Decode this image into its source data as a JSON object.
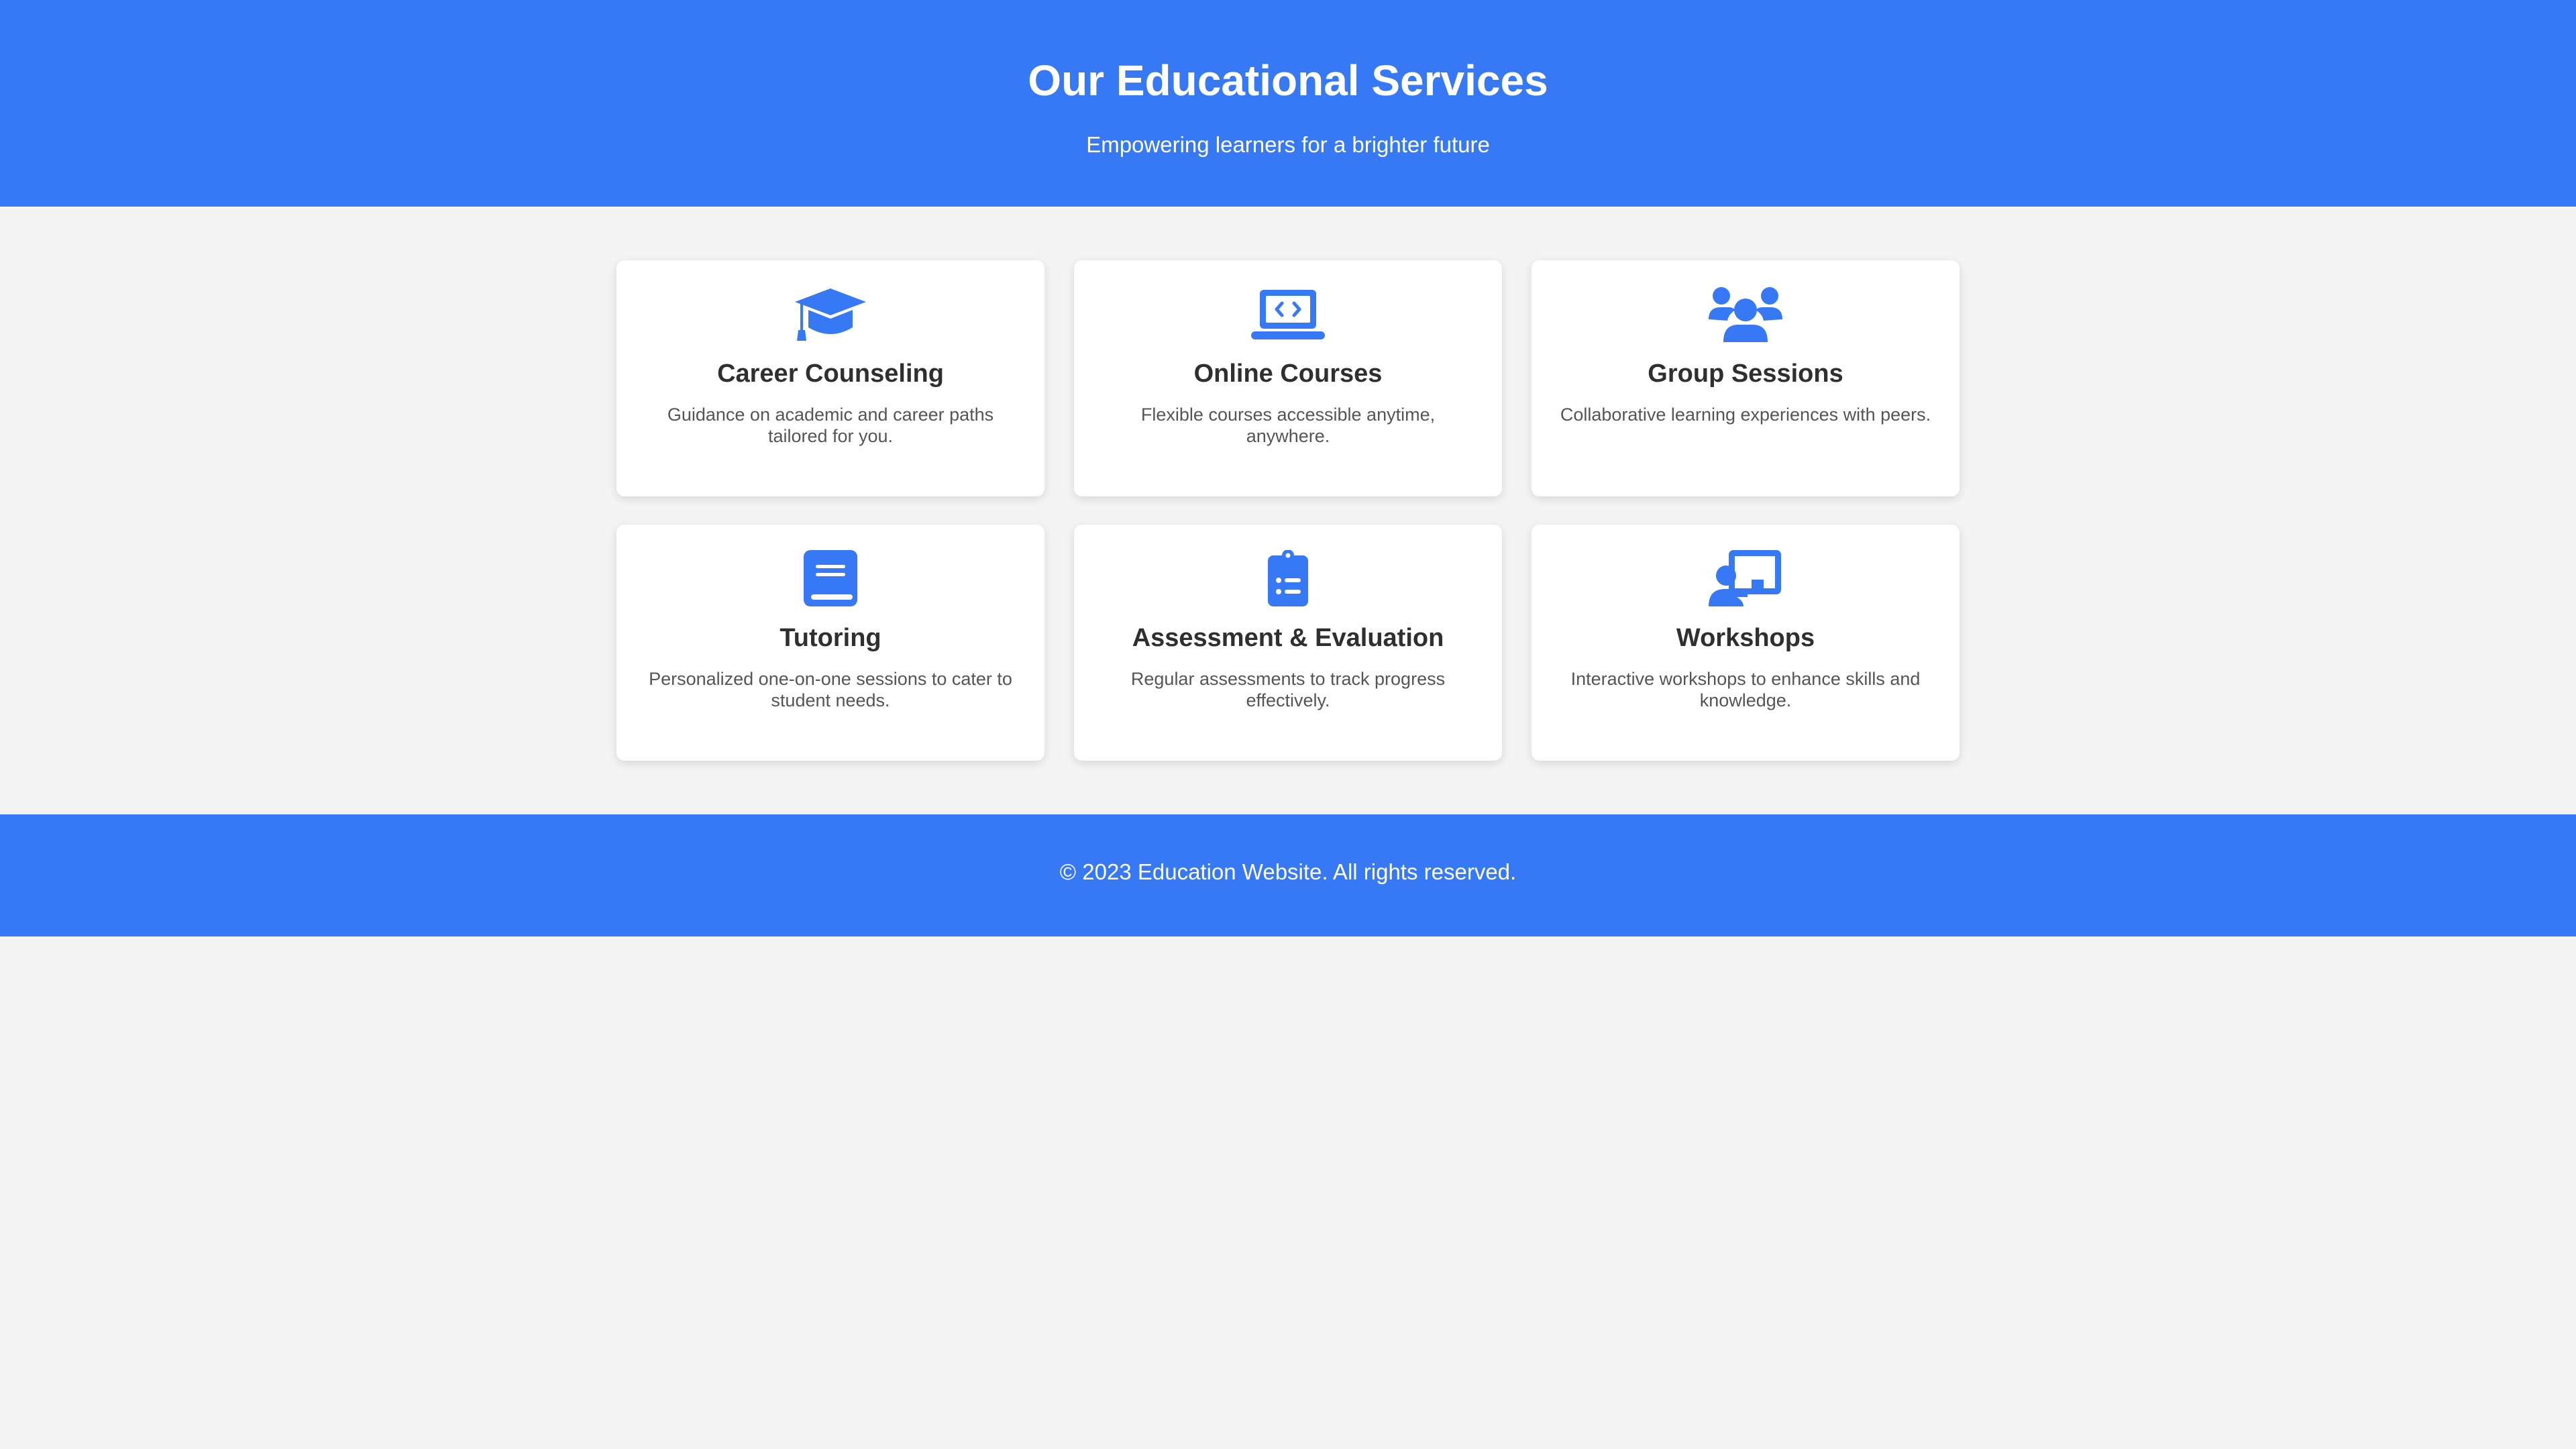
{
  "colors": {
    "accent": "#3779f5",
    "background": "#f4f4f4",
    "card": "#ffffff",
    "heading": "#2f2f2f",
    "body_text": "#555555"
  },
  "header": {
    "title": "Our Educational Services",
    "subtitle": "Empowering learners for a brighter future"
  },
  "services": [
    {
      "icon": "graduation-cap-icon",
      "title": "Career Counseling",
      "description": "Guidance on academic and career paths tailored for you."
    },
    {
      "icon": "laptop-code-icon",
      "title": "Online Courses",
      "description": "Flexible courses accessible anytime, anywhere."
    },
    {
      "icon": "users-group-icon",
      "title": "Group Sessions",
      "description": "Collaborative learning experiences with peers."
    },
    {
      "icon": "book-icon",
      "title": "Tutoring",
      "description": "Personalized one-on-one sessions to cater to student needs."
    },
    {
      "icon": "clipboard-list-icon",
      "title": "Assessment & Evaluation",
      "description": "Regular assessments to track progress effectively."
    },
    {
      "icon": "teacher-board-icon",
      "title": "Workshops",
      "description": "Interactive workshops to enhance skills and knowledge."
    }
  ],
  "footer": {
    "copyright": "© 2023 Education Website. All rights reserved."
  }
}
